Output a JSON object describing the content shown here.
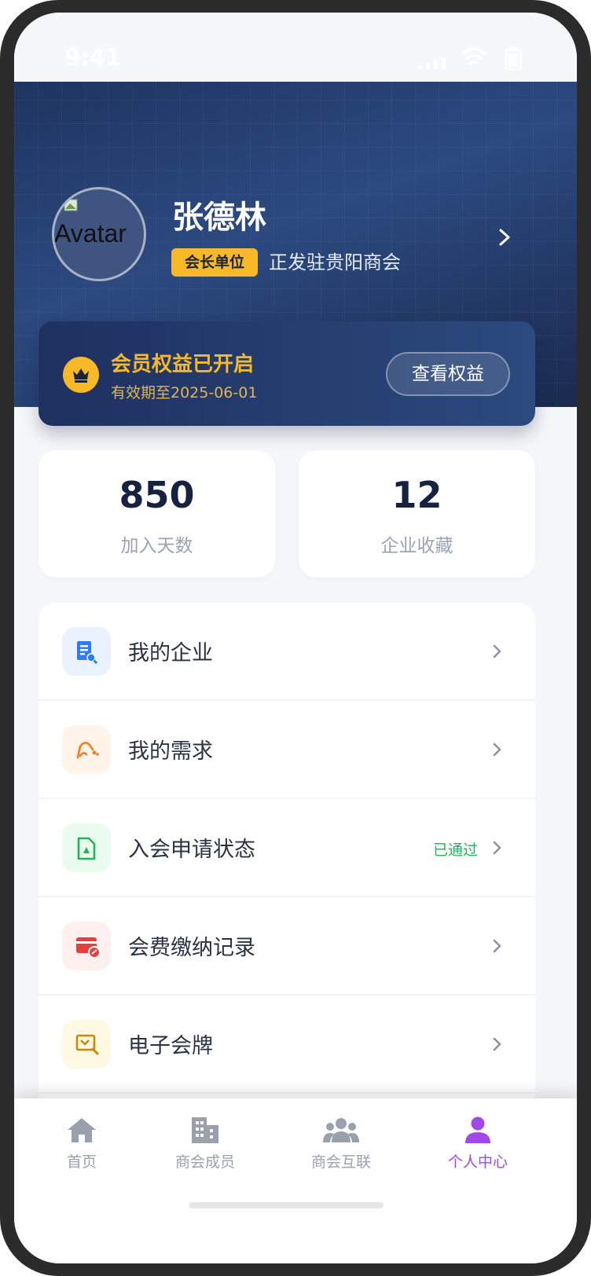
{
  "status_bar": {
    "time": "9:41"
  },
  "profile": {
    "avatar_alt": "Avatar",
    "name": "张德林",
    "role_badge": "会长单位",
    "organization": "正发驻贵阳商会"
  },
  "membership": {
    "title": "会员权益已开启",
    "expiry": "有效期至2025-06-01",
    "button_label": "查看权益"
  },
  "stats": [
    {
      "value": "850",
      "label": "加入天数"
    },
    {
      "value": "12",
      "label": "企业收藏"
    }
  ],
  "menu": [
    {
      "label": "我的企业",
      "icon": "company-doc-icon",
      "color": "#2f7bf5",
      "bg": "#eaf2ff",
      "status": ""
    },
    {
      "label": "我的需求",
      "icon": "handshake-icon",
      "color": "#f07f1f",
      "bg": "#fff3ea",
      "status": ""
    },
    {
      "label": "入会申请状态",
      "icon": "application-file-icon",
      "color": "#22b45a",
      "bg": "#eafbf0",
      "status": "已通过"
    },
    {
      "label": "会费缴纳记录",
      "icon": "payment-card-icon",
      "color": "#ea3d3d",
      "bg": "#fff0f0",
      "status": ""
    },
    {
      "label": "电子会牌",
      "icon": "certificate-icon",
      "color": "#c98a08",
      "bg": "#fff9e3",
      "status": ""
    }
  ],
  "tabbar": [
    {
      "label": "首页",
      "icon": "home-icon",
      "active": false
    },
    {
      "label": "商会成员",
      "icon": "building-icon",
      "active": false
    },
    {
      "label": "商会互联",
      "icon": "users-icon",
      "active": false
    },
    {
      "label": "个人中心",
      "icon": "user-icon",
      "active": true
    }
  ],
  "colors": {
    "accent": "#a048e8",
    "gold": "#f7b928",
    "navy": "#1e3160"
  }
}
